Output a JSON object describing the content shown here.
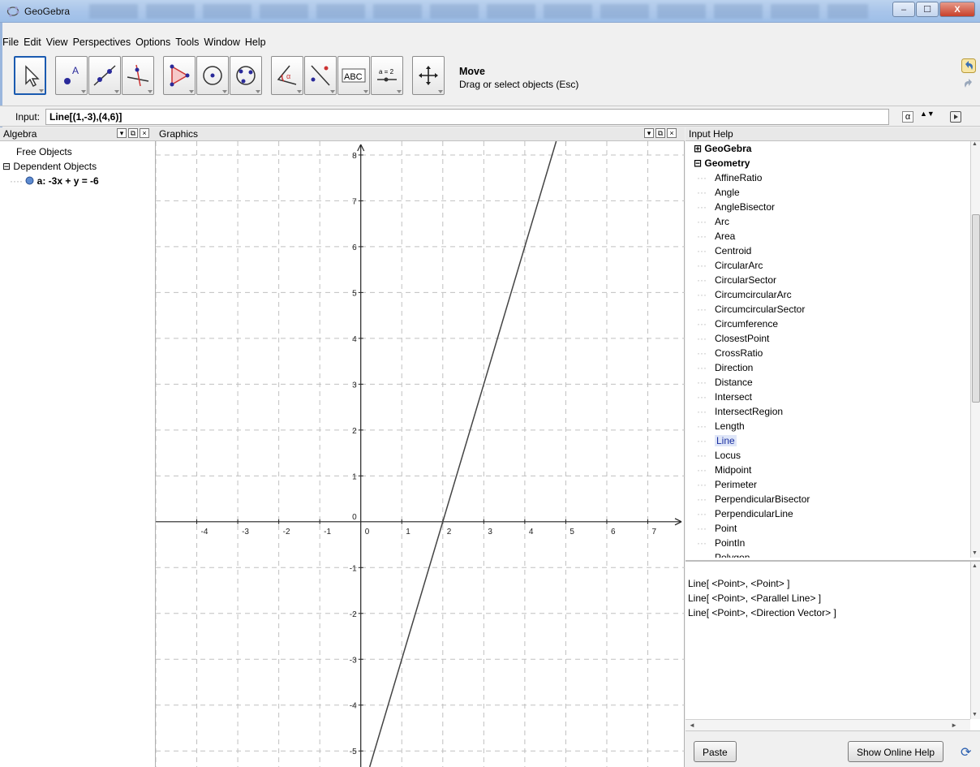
{
  "window": {
    "title": "GeoGebra",
    "minimize_label": "–",
    "maximize_label": "☐",
    "close_label": "X"
  },
  "menu": [
    "File",
    "Edit",
    "View",
    "Perspectives",
    "Options",
    "Tools",
    "Window",
    "Help"
  ],
  "toolbar": {
    "tools": [
      {
        "name": "move-tool",
        "icon": "pointer-arrow-icon"
      },
      {
        "name": "point-tool",
        "icon": "point-icon"
      },
      {
        "name": "line-tool",
        "icon": "line-through-points-icon"
      },
      {
        "name": "perpendicular-tool",
        "icon": "perpendicular-line-icon"
      },
      {
        "name": "polygon-tool",
        "icon": "polygon-icon"
      },
      {
        "name": "circle-center-tool",
        "icon": "circle-center-icon"
      },
      {
        "name": "circle-three-points-tool",
        "icon": "circle-three-points-icon"
      },
      {
        "name": "angle-tool",
        "icon": "angle-icon"
      },
      {
        "name": "reflect-tool",
        "icon": "reflect-point-icon"
      },
      {
        "name": "text-tool",
        "icon": "text-abc-icon",
        "label": "ABC"
      },
      {
        "name": "slider-tool",
        "icon": "slider-icon",
        "label": "a = 2"
      },
      {
        "name": "move-graphics-tool",
        "icon": "move-view-icon"
      }
    ],
    "current_tool_name": "Move",
    "current_tool_desc": "Drag or select objects (Esc)"
  },
  "input_bar": {
    "label": "Input:",
    "value": "Line[(1,-3),(4,6)]",
    "alpha_symbol": "α",
    "spin_symbol": "▲▼"
  },
  "algebra": {
    "title": "Algebra",
    "free_objects": "Free Objects",
    "dependent_objects": "Dependent Objects",
    "expand_symbol": "⊟",
    "items": [
      {
        "label": "a: -3x + y = -6"
      }
    ]
  },
  "graphics": {
    "title": "Graphics",
    "x_ticks": [
      "-4",
      "-3",
      "-2",
      "-1",
      "0",
      "1",
      "2",
      "3",
      "4",
      "5",
      "6",
      "7"
    ],
    "y_ticks": [
      "8",
      "7",
      "6",
      "5",
      "4",
      "3",
      "2",
      "1",
      "0",
      "-1",
      "-2",
      "-3",
      "-4",
      "-5"
    ],
    "line": {
      "slope": 3,
      "intercept": -6,
      "color": "#444444"
    },
    "x_range": [
      -5,
      7.9
    ],
    "y_range": [
      -5.35,
      8.3
    ],
    "grid": true
  },
  "input_help": {
    "title": "Input Help",
    "categories": [
      {
        "label": "GeoGebra",
        "symbol": "⊞",
        "expanded": false
      },
      {
        "label": "Geometry",
        "symbol": "⊟",
        "expanded": true
      }
    ],
    "commands": [
      "AffineRatio",
      "Angle",
      "AngleBisector",
      "Arc",
      "Area",
      "Centroid",
      "CircularArc",
      "CircularSector",
      "CircumcircularArc",
      "CircumcircularSector",
      "Circumference",
      "ClosestPoint",
      "CrossRatio",
      "Direction",
      "Distance",
      "Intersect",
      "IntersectRegion",
      "Length",
      "Line",
      "Locus",
      "Midpoint",
      "Perimeter",
      "PerpendicularBisector",
      "PerpendicularLine",
      "Point",
      "PointIn",
      "Polygon"
    ],
    "selected": "Line",
    "syntax": [
      "Line[ <Point>, <Point> ]",
      "Line[ <Point>, <Parallel Line> ]",
      "Line[ <Point>, <Direction Vector> ]"
    ],
    "paste_label": "Paste",
    "online_help_label": "Show Online Help",
    "refresh_symbol": "⟳",
    "scroll_up_symbol": "▲",
    "scroll_down_symbol": "▼",
    "scroll_left_symbol": "◄",
    "scroll_right_symbol": "►"
  },
  "colors": {
    "accent": "#1a5ab0",
    "titlebar": "#a9c5ea",
    "selection": "#dfe6f8"
  }
}
